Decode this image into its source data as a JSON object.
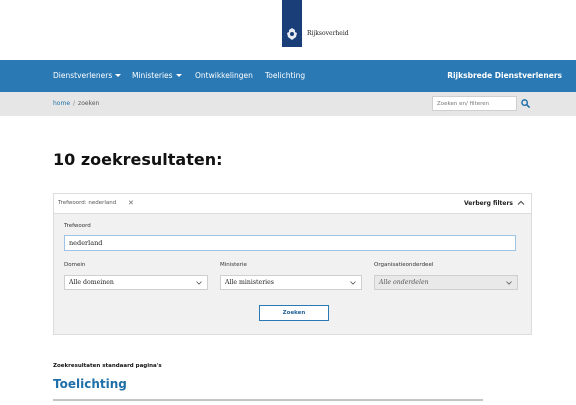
{
  "header": {
    "logo_text": "Rijksoverheid"
  },
  "nav": {
    "items": [
      {
        "label": "Dienstverleners",
        "has_dropdown": true
      },
      {
        "label": "Ministeries",
        "has_dropdown": true
      },
      {
        "label": "Ontwikkelingen",
        "has_dropdown": false
      },
      {
        "label": "Toelichting",
        "has_dropdown": false
      }
    ],
    "right_label": "Rijksbrede Dienstverleners"
  },
  "breadcrumb": {
    "home": "home",
    "separator": "/",
    "current": "zoeken"
  },
  "search": {
    "placeholder": "Zoeken en/ filteren"
  },
  "main": {
    "results_title": "10 zoekresultaten:"
  },
  "filters": {
    "active_tag": "Trefwoord: nederland",
    "remove_symbol": "✕",
    "toggle_label": "Verberg filters",
    "trefwoord_label": "Trefwoord",
    "trefwoord_value": "nederland",
    "domein_label": "Domein",
    "domein_value": "Alle domeinen",
    "ministerie_label": "Ministerie",
    "ministerie_value": "Alle ministeries",
    "organisatie_label": "Organisatieonderdeel",
    "organisatie_value": "Alle onderdelen",
    "submit_label": "Zoeken"
  },
  "results": {
    "section_label": "Zoekresultaten standaard pagina's",
    "first_title": "Toelichting"
  },
  "colors": {
    "nav_blue": "#2a79b5",
    "logo_blue": "#1a3f78",
    "link_blue": "#1f6fa8"
  }
}
